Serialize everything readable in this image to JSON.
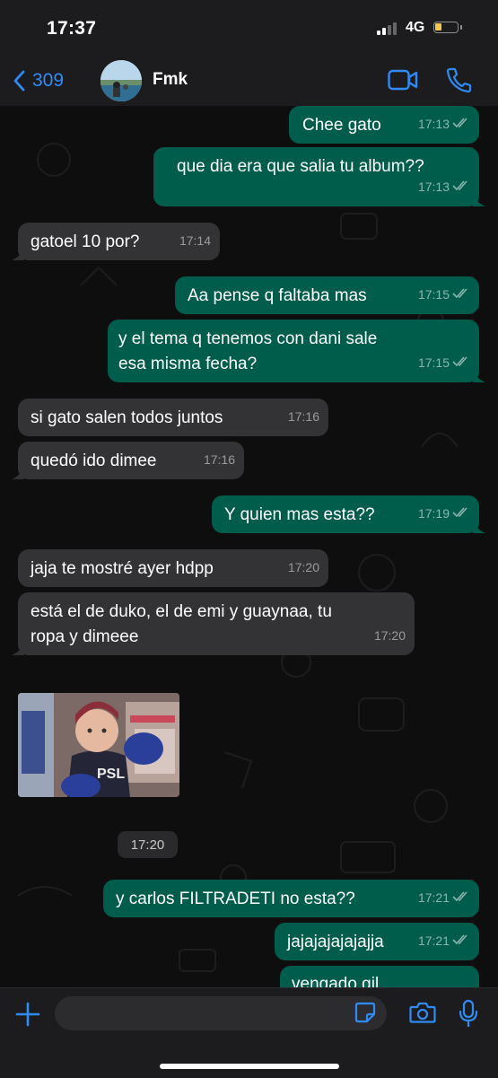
{
  "status": {
    "time": "17:37",
    "network": "4G",
    "battery_level": 0.3
  },
  "header": {
    "back_count": "309",
    "contact_name": "Fmk"
  },
  "messages": [
    {
      "dir": "out",
      "text": "Chee gato",
      "time": "17:13"
    },
    {
      "dir": "out",
      "text": "que dia era que salia tu album??",
      "time": "17:13"
    },
    {
      "dir": "in",
      "text": "gatoel 10 por?",
      "time": "17:14"
    },
    {
      "dir": "out",
      "text": "Aa pense q faltaba mas",
      "time": "17:15"
    },
    {
      "dir": "out",
      "text": "y el tema q tenemos con dani sale esa misma fecha?",
      "time": "17:15"
    },
    {
      "dir": "in",
      "text": "si gato salen todos juntos",
      "time": "17:16"
    },
    {
      "dir": "in",
      "text": "quedó ido dimee",
      "time": "17:16"
    },
    {
      "dir": "out",
      "text": "Y quien mas esta??",
      "time": "17:19"
    },
    {
      "dir": "in",
      "text": "jaja te mostré ayer hdpp",
      "time": "17:20"
    },
    {
      "dir": "in",
      "text": "está el de duko, el de emi y guaynaa, tu ropa y dimeee",
      "time": "17:20"
    },
    {
      "dir": "out",
      "text": "y carlos FILTRADETI no esta??",
      "time": "17:21"
    },
    {
      "dir": "out",
      "text": "jajajajajajajja",
      "time": "17:21"
    },
    {
      "dir": "out",
      "text": "vengado gil",
      "time": ""
    }
  ],
  "gif_time": "17:20",
  "input": {
    "placeholder": ""
  },
  "colors": {
    "outgoing": "#005c4b",
    "incoming": "#333336",
    "accent": "#2f8bf6"
  }
}
